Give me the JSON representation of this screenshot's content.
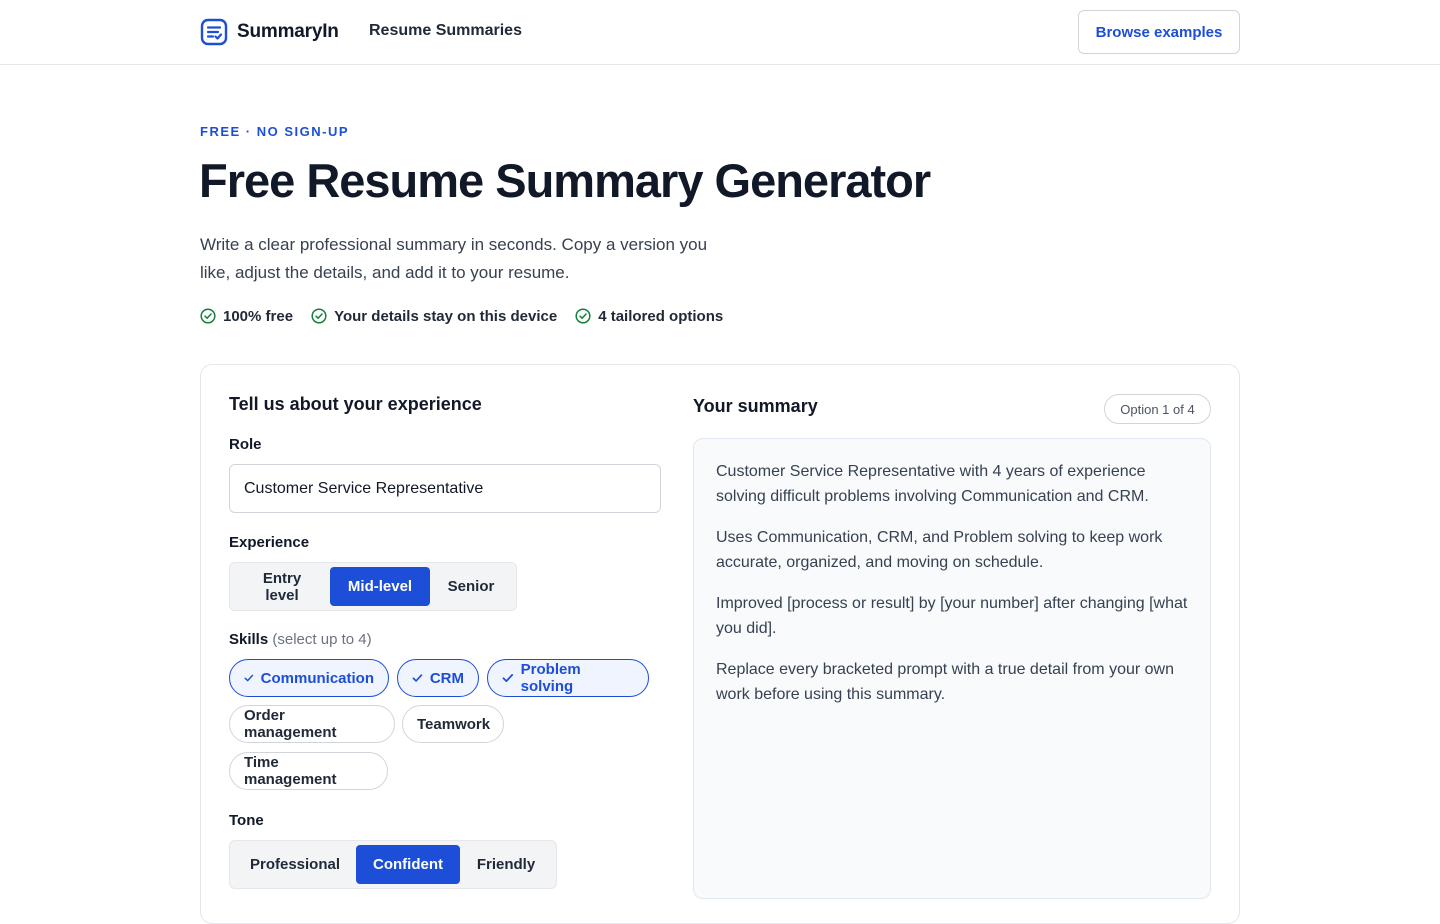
{
  "header": {
    "brand": "SummaryIn",
    "nav_link": "Resume Summaries",
    "browse_button": "Browse examples"
  },
  "hero": {
    "eyebrow": "FREE · NO SIGN-UP",
    "title": "Free Resume Summary Generator",
    "subtitle": "Write a clear professional summary in seconds. Copy a version you like, adjust the details, and add it to your resume.",
    "badges": [
      "100% free",
      "Your details stay on this device",
      "4 tailored options"
    ]
  },
  "form": {
    "title": "Tell us about your experience",
    "role_label": "Role",
    "role_value": "Customer Service Representative",
    "experience_label": "Experience",
    "experience_options": [
      "Entry level",
      "Mid-level",
      "Senior"
    ],
    "experience_selected": "Mid-level",
    "skills_label": "Skills",
    "skills_hint": "(select up to 4)",
    "skills": [
      {
        "label": "Communication",
        "selected": true
      },
      {
        "label": "CRM",
        "selected": true
      },
      {
        "label": "Problem solving",
        "selected": true
      },
      {
        "label": "Order management",
        "selected": false
      },
      {
        "label": "Teamwork",
        "selected": false
      },
      {
        "label": "Time management",
        "selected": false
      }
    ],
    "tone_label": "Tone",
    "tone_options": [
      "Professional",
      "Confident",
      "Friendly"
    ],
    "tone_selected": "Confident"
  },
  "summary": {
    "title": "Your summary",
    "option_indicator": "Option 1 of 4",
    "paragraphs": [
      "Customer Service Representative with 4 years of experience solving difficult problems involving Communication and CRM.",
      "Uses Communication, CRM, and Problem solving to keep work accurate, organized, and moving on schedule.",
      "Improved [process or result] by [your number] after changing [what you did].",
      "Replace every bracketed prompt with a true detail from your own work before using this summary."
    ]
  },
  "colors": {
    "accent": "#1d4ed8",
    "success": "#15803d",
    "text": "#111827",
    "panel_bg": "#f8fafc"
  },
  "icons": {
    "logo": "document-lines-check-icon",
    "badge": "check-circle-icon",
    "chip_selected": "checkmark-icon"
  }
}
